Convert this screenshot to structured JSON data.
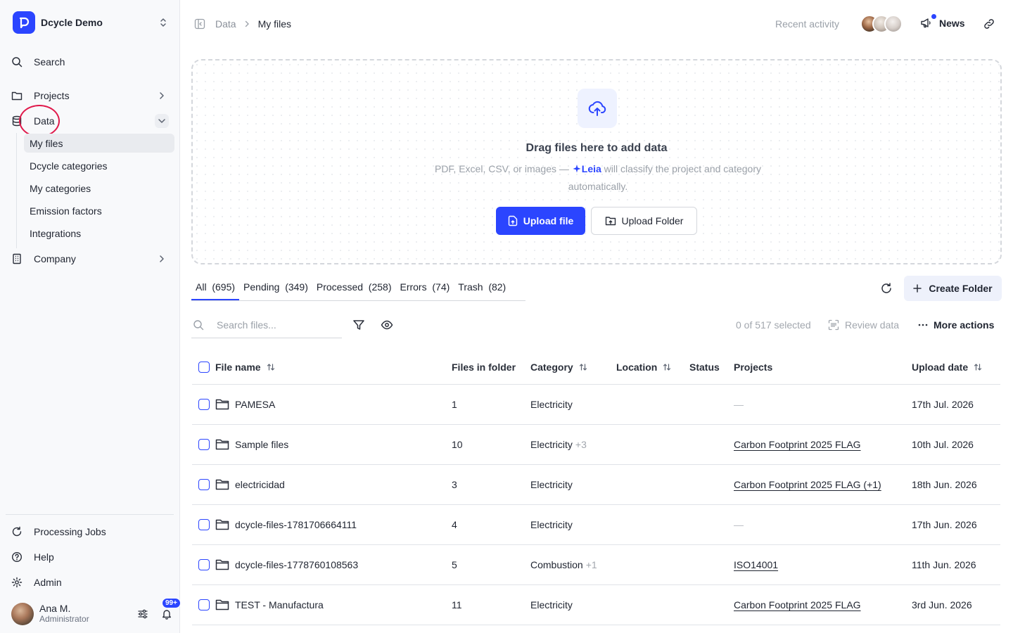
{
  "workspace": {
    "name": "Dcycle Demo"
  },
  "sidebar": {
    "search": "Search",
    "projects": "Projects",
    "data": "Data",
    "sub_items": [
      "My files",
      "Dcycle categories",
      "My categories",
      "Emission factors",
      "Integrations"
    ],
    "company": "Company",
    "processing_jobs": "Processing Jobs",
    "help": "Help",
    "admin": "Admin"
  },
  "user": {
    "name": "Ana M.",
    "role": "Administrator",
    "notifications": "99+"
  },
  "header": {
    "breadcrumb": [
      "Data",
      "My files"
    ],
    "recent_activity": "Recent activity",
    "news": "News"
  },
  "dropzone": {
    "title": "Drag files here to add data",
    "desc_before": "PDF, Excel, CSV, or images —",
    "leia": "Leia",
    "desc_after": "will classify the project and category automatically.",
    "upload_file": "Upload file",
    "upload_folder": "Upload Folder"
  },
  "tabs": [
    "All  (695)",
    "Pending  (349)",
    "Processed  (258)",
    "Errors  (74)",
    "Trash  (82)"
  ],
  "actions": {
    "create_folder": "Create Folder",
    "selected": "0 of 517 selected",
    "review": "Review data",
    "more": "More actions"
  },
  "search": {
    "placeholder": "Search files..."
  },
  "table": {
    "columns": [
      "File name",
      "Files in folder",
      "Category",
      "Location",
      "Status",
      "Projects",
      "Upload date"
    ],
    "rows": [
      {
        "name": "PAMESA",
        "files": "1",
        "category": "Electricity",
        "extra": "",
        "projects": "—",
        "date": "17th Jul. 2026"
      },
      {
        "name": "Sample files",
        "files": "10",
        "category": "Electricity",
        "extra": "+3",
        "projects": "Carbon Footprint 2025 FLAG",
        "date": "10th Jul. 2026"
      },
      {
        "name": "electricidad",
        "files": "3",
        "category": "Electricity",
        "extra": "",
        "projects": "Carbon Footprint 2025 FLAG (+1)",
        "date": "18th Jun. 2026"
      },
      {
        "name": "dcycle-files-1781706664111",
        "files": "4",
        "category": "Electricity",
        "extra": "",
        "projects": "—",
        "date": "17th Jun. 2026"
      },
      {
        "name": "dcycle-files-1778760108563",
        "files": "5",
        "category": "Combustion",
        "extra": "+1",
        "projects": "ISO14001",
        "date": "11th Jun. 2026"
      },
      {
        "name": "TEST - Manufactura",
        "files": "11",
        "category": "Electricity",
        "extra": "",
        "projects": "Carbon Footprint 2025 FLAG",
        "date": "3rd Jun. 2026"
      }
    ]
  }
}
